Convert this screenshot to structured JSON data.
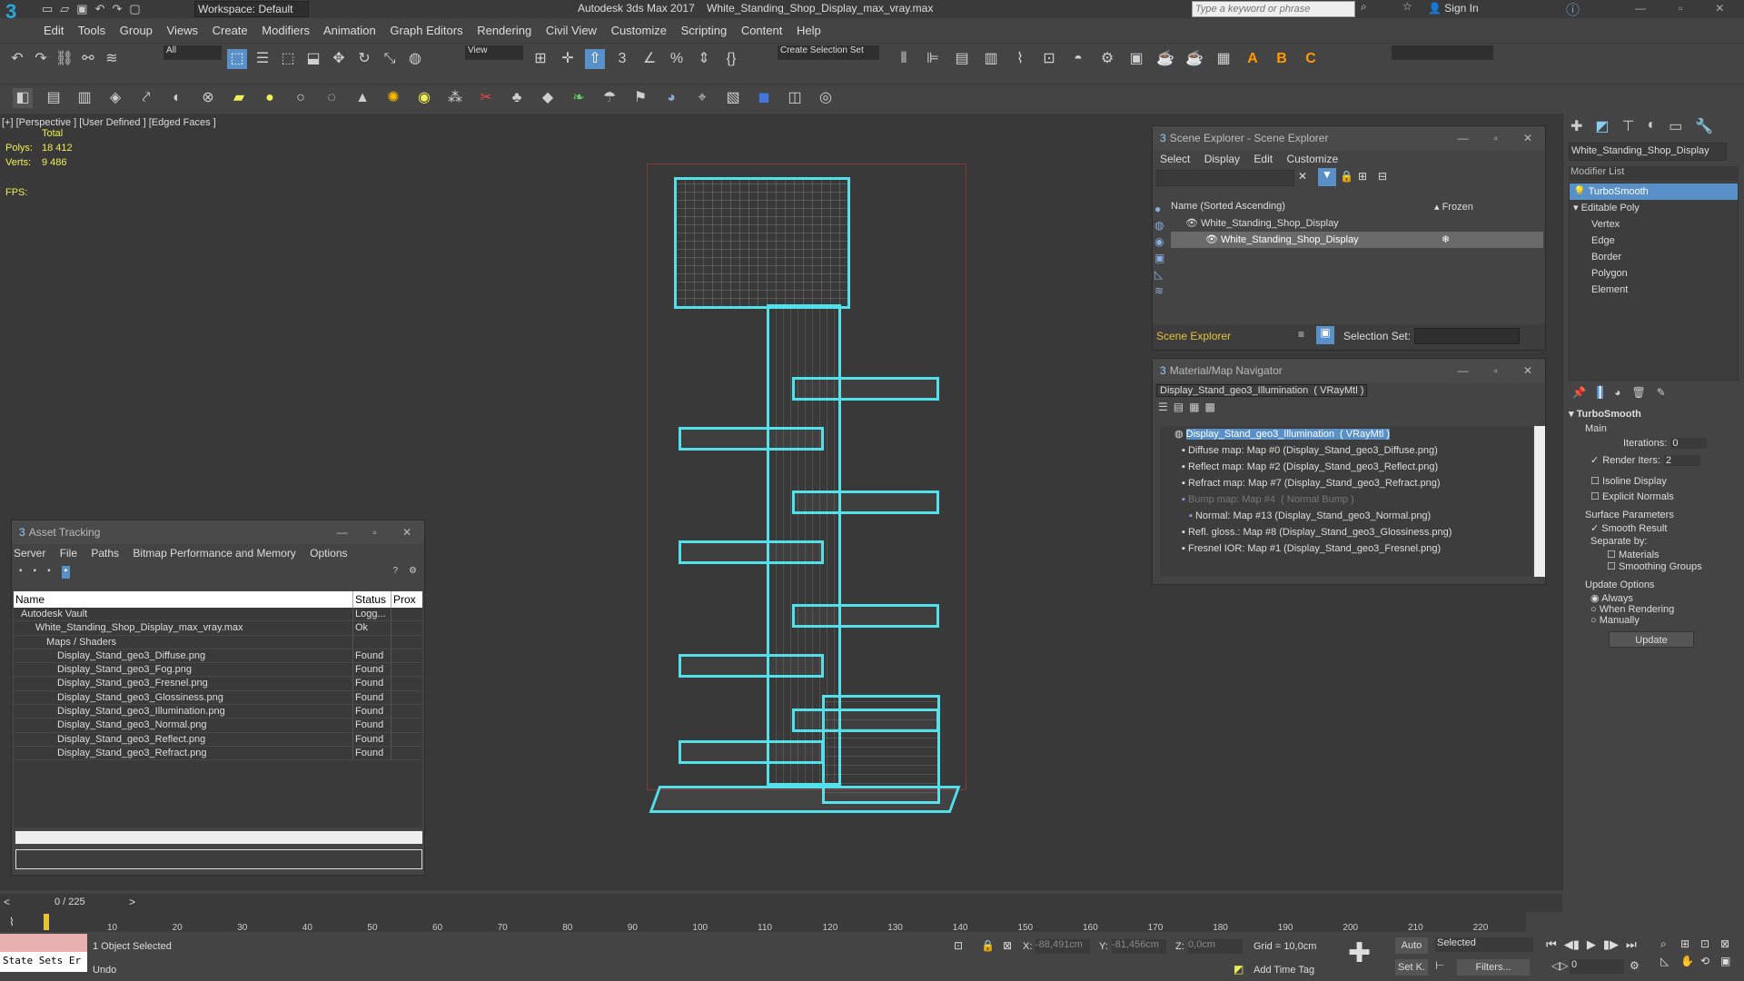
{
  "titlebar": {
    "workspace": "Workspace: Default",
    "title": "Autodesk 3ds Max 2017    White_Standing_Shop_Display_max_vray.max",
    "search_placeholder": "Type a keyword or phrase",
    "signin": "Sign In"
  },
  "menus": [
    "Edit",
    "Tools",
    "Group",
    "Views",
    "Create",
    "Modifiers",
    "Animation",
    "Graph Editors",
    "Rendering",
    "Civil View",
    "Customize",
    "Scripting",
    "Content",
    "Help"
  ],
  "toolbar": {
    "filter": "All",
    "view": "View",
    "selection_set": "Create Selection Set"
  },
  "viewport": {
    "label": "[+] [Perspective ] [User Defined ] [Edged Faces ]",
    "stats_total": "Total",
    "polys_label": "Polys:",
    "polys": "18 412",
    "verts_label": "Verts:",
    "verts": "9 486",
    "fps_label": "FPS:"
  },
  "scene_explorer": {
    "title": "Scene Explorer - Scene Explorer",
    "menu": [
      "Select",
      "Display",
      "Edit",
      "Customize"
    ],
    "col_name": "Name (Sorted Ascending)",
    "col_frozen": "▴ Frozen",
    "rows": [
      "White_Standing_Shop_Display",
      "White_Standing_Shop_Display"
    ],
    "footer_label": "Scene Explorer",
    "selection_set_label": "Selection Set:"
  },
  "material_nav": {
    "title": "Material/Map Navigator",
    "current": "Display_Stand_geo3_Illumination  ( VRayMtl )",
    "rows": [
      "Display_Stand_geo3_Illumination  ( VRayMtl )",
      "Diffuse map: Map #0 (Display_Stand_geo3_Diffuse.png)",
      "Reflect map: Map #2 (Display_Stand_geo3_Reflect.png)",
      "Refract map: Map #7 (Display_Stand_geo3_Refract.png)",
      "Bump map: Map #4  ( Normal Bump )",
      "Normal: Map #13 (Display_Stand_geo3_Normal.png)",
      "Refl. gloss.: Map #8 (Display_Stand_geo3_Glossiness.png)",
      "Fresnel IOR: Map #1 (Display_Stand_geo3_Fresnel.png)"
    ]
  },
  "asset_tracking": {
    "title": "Asset Tracking",
    "menu": [
      "Server",
      "File",
      "Paths",
      "Bitmap Performance and Memory",
      "Options"
    ],
    "cols": [
      "Name",
      "Status",
      "Prox"
    ],
    "rows": [
      {
        "name": "Autodesk Vault",
        "status": "Logg..."
      },
      {
        "name": "White_Standing_Shop_Display_max_vray.max",
        "status": "Ok"
      },
      {
        "name": "Maps / Shaders",
        "status": ""
      },
      {
        "name": "Display_Stand_geo3_Diffuse.png",
        "status": "Found"
      },
      {
        "name": "Display_Stand_geo3_Fog.png",
        "status": "Found"
      },
      {
        "name": "Display_Stand_geo3_Fresnel.png",
        "status": "Found"
      },
      {
        "name": "Display_Stand_geo3_Glossiness.png",
        "status": "Found"
      },
      {
        "name": "Display_Stand_geo3_Illumination.png",
        "status": "Found"
      },
      {
        "name": "Display_Stand_geo3_Normal.png",
        "status": "Found"
      },
      {
        "name": "Display_Stand_geo3_Reflect.png",
        "status": "Found"
      },
      {
        "name": "Display_Stand_geo3_Refract.png",
        "status": "Found"
      }
    ]
  },
  "command_panel": {
    "object_name": "White_Standing_Shop_Display",
    "modifier_list": "Modifier List",
    "stack": [
      "TurboSmooth",
      "Editable Poly",
      "Vertex",
      "Edge",
      "Border",
      "Polygon",
      "Element"
    ],
    "turbosmooth": {
      "title": "TurboSmooth",
      "main": "Main",
      "iterations_label": "Iterations:",
      "iterations": "0",
      "render_iters_label": "Render Iters:",
      "render_iters": "2",
      "isoline": "Isoline Display",
      "explicit": "Explicit Normals",
      "surface": "Surface Parameters",
      "smooth_result": "Smooth Result",
      "separate_by": "Separate by:",
      "materials": "Materials",
      "smoothing_groups": "Smoothing Groups",
      "update_options": "Update Options",
      "always": "Always",
      "when_rendering": "When Rendering",
      "manually": "Manually",
      "update": "Update"
    }
  },
  "timeline": {
    "frame": "0 / 225",
    "ticks": [
      "10",
      "20",
      "30",
      "40",
      "50",
      "60",
      "70",
      "80",
      "90",
      "100",
      "110",
      "120",
      "130",
      "140",
      "150",
      "160",
      "170",
      "180",
      "190",
      "200",
      "210",
      "220"
    ]
  },
  "status": {
    "state_sets": "State Sets Er",
    "selected": "1 Object Selected",
    "undo": "Undo",
    "x_label": "X:",
    "x": "-88,491cm",
    "y_label": "Y:",
    "y": "-81,456cm",
    "z_label": "Z:",
    "z": "0,0cm",
    "grid": "Grid = 10,0cm",
    "add_time_tag": "Add Time Tag",
    "auto": "Auto",
    "set_k": "Set K.",
    "selected_dd": "Selected",
    "filters": "Filters...",
    "frame_field": "0"
  }
}
